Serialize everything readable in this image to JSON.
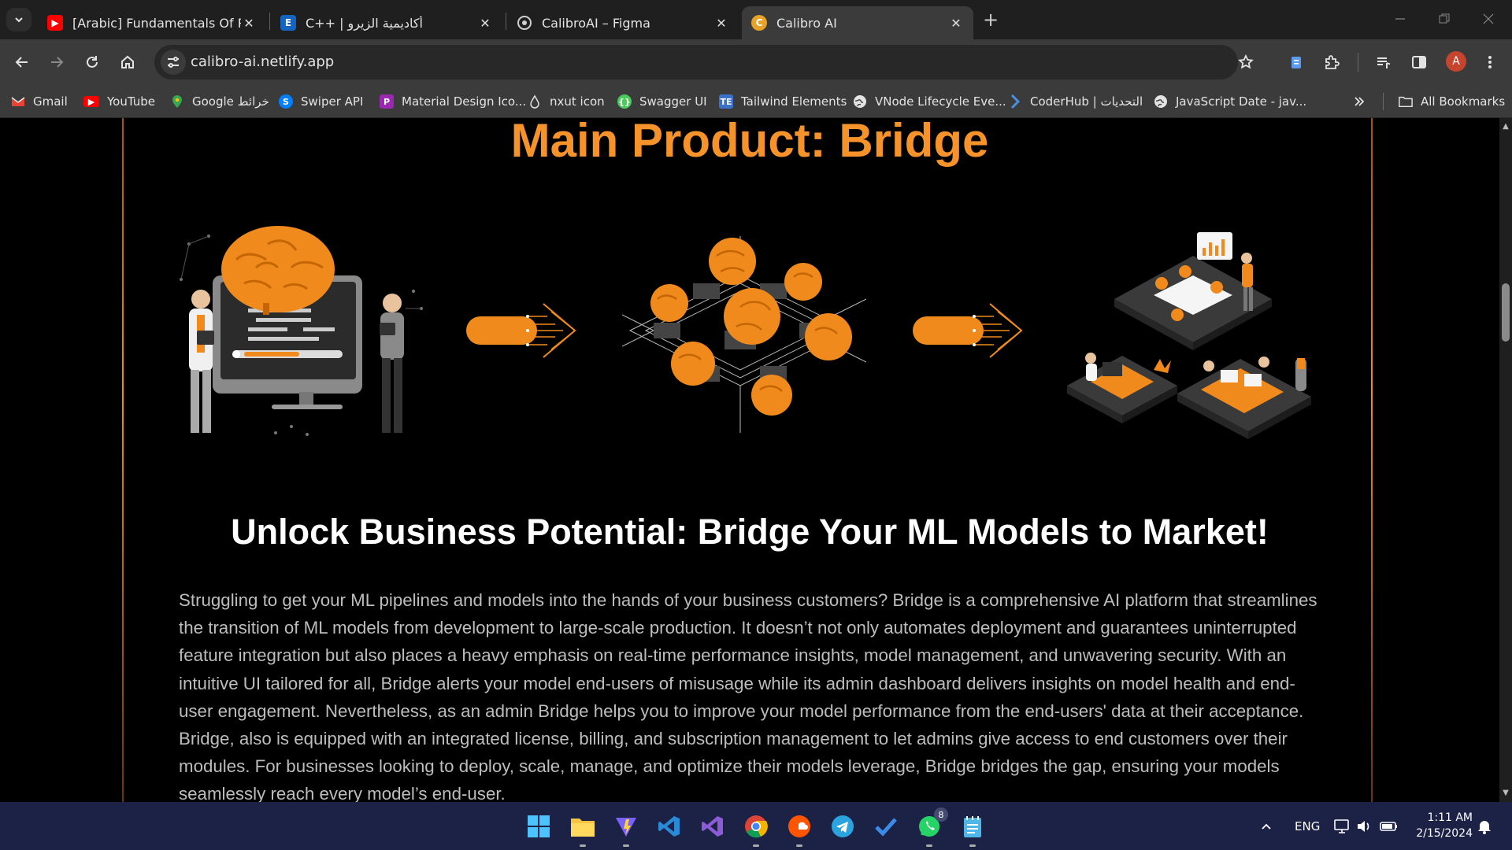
{
  "browser": {
    "tabs": [
      {
        "title": "[Arabic] Fundamentals Of Progr",
        "icon": "youtube-icon",
        "active": false
      },
      {
        "title": "C++ | أكاديمية الزيرو",
        "icon": "e-letter-icon",
        "active": false
      },
      {
        "title": "CalibroAI – Figma",
        "icon": "calibro-globe-icon",
        "active": false
      },
      {
        "title": "Calibro AI",
        "icon": "calibro-logo-icon",
        "active": true
      }
    ],
    "address": "calibro-ai.netlify.app",
    "profile_initial": "A",
    "bookmarks": [
      {
        "label": "Gmail",
        "icon": "gmail-icon"
      },
      {
        "label": "YouTube",
        "icon": "youtube-icon"
      },
      {
        "label": "Google خرائط",
        "icon": "maps-pin-icon"
      },
      {
        "label": "Swiper API",
        "icon": "swiper-icon"
      },
      {
        "label": "Material Design Ico...",
        "icon": "material-design-icon"
      },
      {
        "label": "nxut icon",
        "icon": "nuxt-icon"
      },
      {
        "label": "Swagger UI",
        "icon": "swagger-icon"
      },
      {
        "label": "Tailwind Elements",
        "icon": "tailwind-elements-icon"
      },
      {
        "label": "VNode Lifecycle Eve...",
        "icon": "globe-icon"
      },
      {
        "label": "CoderHub | التحديات",
        "icon": "coderhub-icon"
      },
      {
        "label": "JavaScript Date - jav...",
        "icon": "globe-icon"
      }
    ],
    "all_bookmarks_label": "All Bookmarks"
  },
  "page": {
    "main_title": "Main Product: Bridge",
    "subtitle": "Unlock Business Potential: Bridge Your ML Models to Market!",
    "description": "Struggling to get your ML pipelines and models into the hands of your business customers? Bridge is a comprehensive AI platform that streamlines the transition of ML models from development to large-scale production. It doesn’t not only automates deployment and guarantees uninterrupted feature integration but also places a heavy emphasis on real-time performance insights, model management, and unwavering security. With an intuitive UI tailored for all, Bridge alerts your model end-users of misusage while its admin dashboard delivers insights on model health and end-user engagement. Nevertheless, as an admin Bridge helps you to improve your model performance from the end-users' data at their acceptance. Bridge, also is equipped with an integrated license, billing, and subscription management to let admins give access to end customers over their modules. For businesses looking to deploy, scale, manage, and optimize their models leverage, Bridge bridges the gap, ensuring your models seamlessly reach every model’s end-user.",
    "illustrations": [
      "developers-brain-computer-illustration",
      "arrow-illustration",
      "brain-chip-network-illustration",
      "arrow-illustration",
      "office-teams-illustration"
    ],
    "accent_color": "#f5922a"
  },
  "taskbar": {
    "apps": [
      "windows-start-icon",
      "file-explorer-icon",
      "vite-icon",
      "vscode-icon",
      "visual-studio-icon",
      "chrome-icon",
      "soundcloud-icon",
      "telegram-icon",
      "todo-icon",
      "whatsapp-icon",
      "notepad-icon"
    ],
    "whatsapp_badge": "8",
    "language": "ENG",
    "time": "1:11 AM",
    "date": "2/15/2024"
  }
}
